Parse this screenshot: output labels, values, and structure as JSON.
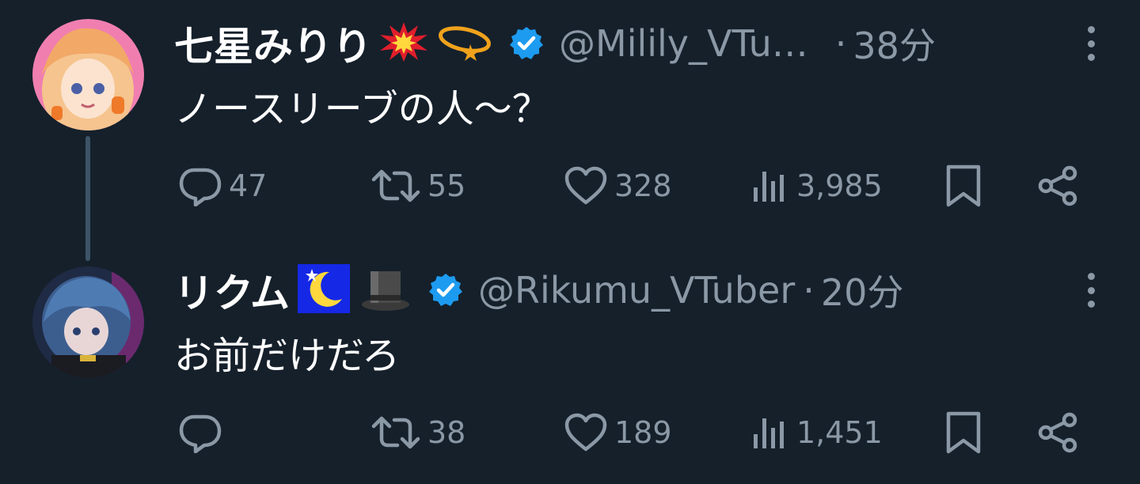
{
  "tweets": [
    {
      "display_name": "七星みりり",
      "handle": "@Milily_VTu…",
      "separator": "·",
      "time": "38分",
      "text": "ノースリーブの人〜？",
      "name_emojis": [
        "collision-emoji",
        "dizzy-emoji"
      ],
      "stats": {
        "replies": "47",
        "retweets": "55",
        "likes": "328",
        "views": "3,985"
      }
    },
    {
      "display_name": "リクム",
      "handle": "@Rikumu_VTuber",
      "separator": "·",
      "time": "20分",
      "text": "お前だけだろ",
      "name_emojis": [
        "crescent-moon-emoji",
        "top-hat-emoji"
      ],
      "stats": {
        "replies": "",
        "retweets": "38",
        "likes": "189",
        "views": "1,451"
      }
    }
  ],
  "colors": {
    "background": "#15202b",
    "muted": "#8b98a5",
    "verified": "#1d9bf0",
    "thread_line": "#3d5466"
  }
}
